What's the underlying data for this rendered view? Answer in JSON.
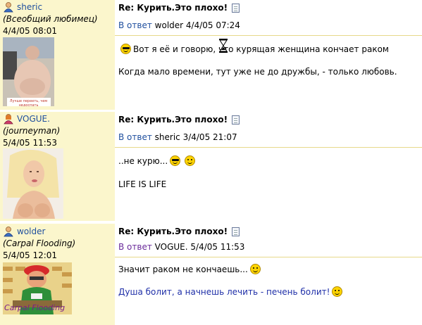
{
  "posts": [
    {
      "username": "sheric",
      "user_title": "(Всеобщий любимец)",
      "date": "4/4/05 08:01",
      "avatar_caption": "Лучше перееть, чем недоспать",
      "subject": "Re: Курить.Это плохо!",
      "reply_label": "В ответ",
      "reply_to": "wolder 4/4/05 07:24",
      "lines": [
        "Вот я её и говорю, что курящая женщина кончает раком",
        "Когда мало времени, тут уже не до дружбы, - только любовь."
      ]
    },
    {
      "username": "VOGUE.",
      "user_title": "(journeyman)",
      "date": "5/4/05 11:53",
      "subject": "Re: Курить.Это плохо!",
      "reply_label": "В ответ",
      "reply_to": "sheric 3/4/05 21:07",
      "lines": [
        "..не курю...",
        "LIFE IS LIFE"
      ]
    },
    {
      "username": "wolder",
      "user_title": "(Carpal Flooding)",
      "date": "5/4/05 12:01",
      "avatar_caption": "Carpal Flooding",
      "subject": "Re: Курить.Это плохо!",
      "reply_label": "В ответ",
      "reply_to": "VOGUE. 5/4/05 11:53",
      "lines": [
        "Значит раком не кончаешь...",
        "Душа болит, а начнешь лечить - печень болит!"
      ]
    }
  ],
  "colors": {
    "sidebar_bg": "#fbf6cc",
    "link_blue": "#1f4f9e",
    "visited_purple": "#6a2a9a",
    "signature_blue": "#1f2fa8"
  },
  "icons": [
    "user-icon",
    "doc-icon",
    "smiley-icon",
    "cool-smiley-icon",
    "hourglass-cursor-icon"
  ]
}
